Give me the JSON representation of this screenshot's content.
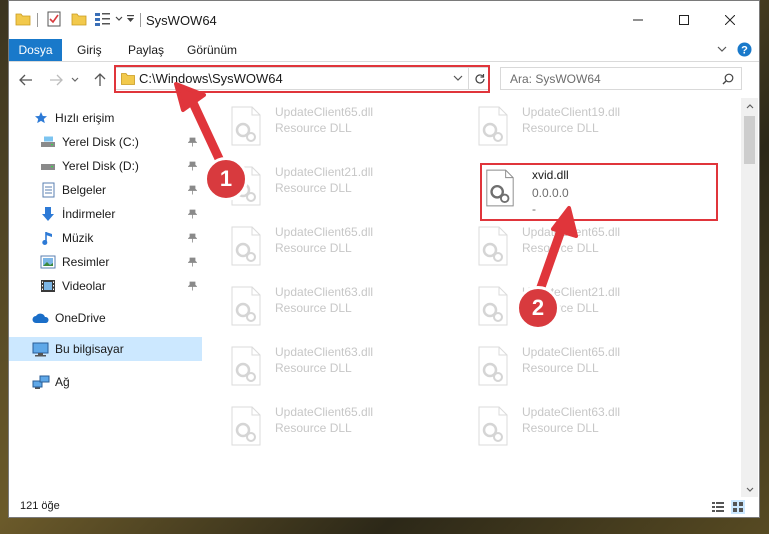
{
  "window": {
    "title": "SysWOW64"
  },
  "ribbon": {
    "file_tab": "Dosya",
    "tabs": [
      "Giriş",
      "Paylaş",
      "Görünüm"
    ]
  },
  "address": {
    "path": "C:\\Windows\\SysWOW64",
    "search_placeholder": "Ara: SysWOW64"
  },
  "sidebar": {
    "quick_access": "Hızlı erişim",
    "items": [
      {
        "label": "Yerel Disk (C:)",
        "icon": "drive-icon",
        "pinned": true
      },
      {
        "label": "Yerel Disk (D:)",
        "icon": "drive-icon",
        "pinned": true
      },
      {
        "label": "Belgeler",
        "icon": "documents-icon",
        "pinned": true
      },
      {
        "label": "İndirmeler",
        "icon": "download-icon",
        "pinned": true
      },
      {
        "label": "Müzik",
        "icon": "music-icon",
        "pinned": true
      },
      {
        "label": "Resimler",
        "icon": "pictures-icon",
        "pinned": true
      },
      {
        "label": "Videolar",
        "icon": "videos-icon",
        "pinned": true
      }
    ],
    "onedrive": "OneDrive",
    "this_pc": "Bu bilgisayar",
    "network": "Ağ"
  },
  "files": {
    "left": [
      {
        "name": "UpdateClient65.dll",
        "type": "Resource DLL"
      },
      {
        "name": "UpdateClient21.dll",
        "type": "Resource DLL"
      },
      {
        "name": "UpdateClient65.dll",
        "type": "Resource DLL"
      },
      {
        "name": "UpdateClient63.dll",
        "type": "Resource DLL"
      },
      {
        "name": "UpdateClient63.dll",
        "type": "Resource DLL"
      },
      {
        "name": "UpdateClient65.dll",
        "type": "Resource DLL"
      }
    ],
    "right": [
      {
        "name": "UpdateClient19.dll",
        "type": "Resource DLL"
      },
      {
        "name": "xvid.dll",
        "type": "0.0.0.0",
        "extra": "-"
      },
      {
        "name": "UpdateClient65.dll",
        "type": "Resource DLL"
      },
      {
        "name": "UpdateClient21.dll",
        "type": "Resource DLL"
      },
      {
        "name": "UpdateClient65.dll",
        "type": "Resource DLL"
      },
      {
        "name": "UpdateClient63.dll",
        "type": "Resource DLL"
      }
    ]
  },
  "status": {
    "item_count": "121 öğe"
  },
  "annotations": {
    "step1": "1",
    "step2": "2",
    "color": "#e0353b"
  },
  "colors": {
    "accent": "#1979ca",
    "selected": "#cce8ff"
  }
}
